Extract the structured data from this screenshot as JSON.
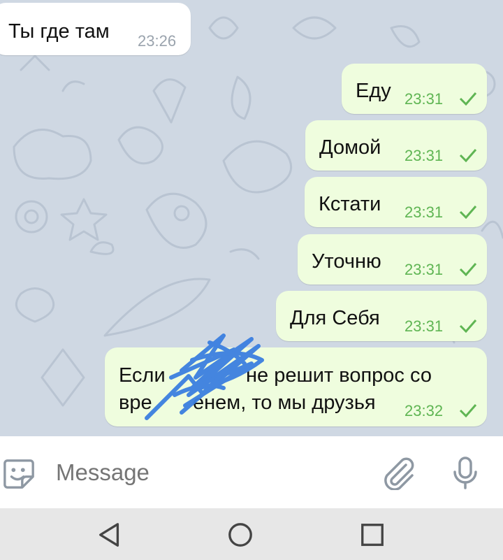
{
  "messages": [
    {
      "direction": "in",
      "text": "Ты где там",
      "time": "23:26"
    },
    {
      "direction": "out",
      "text": "Еду",
      "time": "23:31",
      "status": "sent"
    },
    {
      "direction": "out",
      "text": "Домой",
      "time": "23:31",
      "status": "sent"
    },
    {
      "direction": "out",
      "text": "Кстати",
      "time": "23:31",
      "status": "sent"
    },
    {
      "direction": "out",
      "text": "Уточню",
      "time": "23:31",
      "status": "sent"
    },
    {
      "direction": "out",
      "text": "Для Себя",
      "time": "23:31",
      "status": "sent"
    },
    {
      "direction": "out",
      "text_line1": "Если",
      "text_line1b": "не решит  вопрос со",
      "text_line2a": "вре",
      "text_line2b": "енем, то мы друзья",
      "time": "23:32",
      "status": "sent"
    }
  ],
  "input": {
    "placeholder": "Message"
  },
  "icons": {
    "sticker": "sticker-icon",
    "attach": "paperclip-icon",
    "mic": "microphone-icon",
    "check": "check-icon",
    "back": "back-triangle-icon",
    "home": "home-circle-icon",
    "recents": "recents-square-icon"
  },
  "colors": {
    "chat_background": "#cfd8e3",
    "outgoing_bubble": "#effdde",
    "incoming_bubble": "#ffffff",
    "outgoing_time": "#5fb553",
    "scribble": "#3b7fe0"
  }
}
